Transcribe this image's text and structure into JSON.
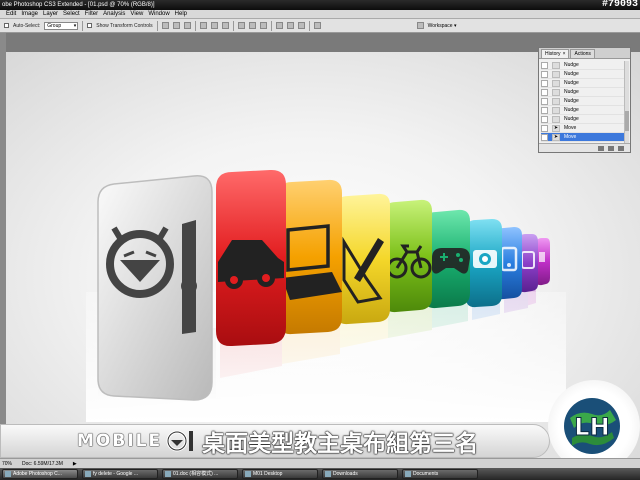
{
  "window": {
    "title": "obe Photoshop CS3 Extended - [01.psd @ 70% (RGB/8)]",
    "watermark_id": "#79093"
  },
  "menu": [
    "Edit",
    "Image",
    "Layer",
    "Select",
    "Filter",
    "Analysis",
    "View",
    "Window",
    "Help"
  ],
  "options": {
    "auto_select_label": "Auto-Select:",
    "auto_select_value": "Group",
    "show_transform_label": "Show Transform Controls",
    "workspace_label": "Workspace ▾"
  },
  "history_panel": {
    "tabs": [
      {
        "label": "History",
        "close": "×"
      },
      {
        "label": "Actions"
      }
    ],
    "rows": [
      {
        "label": "Nudge"
      },
      {
        "label": "Nudge"
      },
      {
        "label": "Nudge"
      },
      {
        "label": "Nudge"
      },
      {
        "label": "Nudge"
      },
      {
        "label": "Nudge"
      },
      {
        "label": "Nudge"
      },
      {
        "label": "Move"
      },
      {
        "label": "Move",
        "selected": true
      }
    ]
  },
  "banner": {
    "brand": "MOBILE",
    "title_cn": "桌面美型教主桌布組第三名"
  },
  "logo": {
    "text": "LH"
  },
  "status": {
    "zoom": "70%",
    "doc": "Doc: 6.59M/17.3M",
    "arrow": "▶"
  },
  "taskbar": [
    {
      "label": "Adobe Photoshop C...",
      "active": true
    },
    {
      "label": "fy delete - Google ..."
    },
    {
      "label": "01.doc (相容模式) ..."
    },
    {
      "label": "M01 Desktop"
    },
    {
      "label": "Downloads"
    },
    {
      "label": "Documents"
    }
  ],
  "colors": {
    "red": "#e21d1f",
    "orange": "#f5a100",
    "yellow": "#f4d72a",
    "green": "#7dc11a",
    "teal": "#19b070",
    "cyan": "#1aa6c4",
    "blue": "#2a7ee0",
    "violet": "#8c3fc8",
    "magenta": "#c02fc8",
    "gray": "#cfcfcf"
  }
}
